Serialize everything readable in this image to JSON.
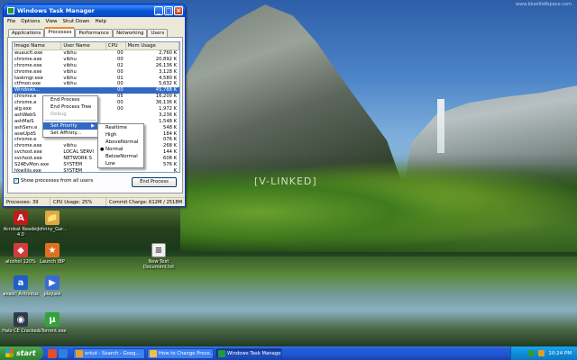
{
  "desktop": {
    "watermark": "[V-LINKED]",
    "site_mark": "www.bluelife8space.com",
    "icons": [
      {
        "label": "Acrobat Reader 4.0",
        "icon": "acrobat-icon",
        "color": "#c21a1a"
      },
      {
        "label": "Johnny_Gar...",
        "icon": "folder-icon",
        "color": "#d9a94a"
      },
      {
        "label": "alcohol 120%",
        "icon": "alcohol-icon",
        "color": "#d23c3c"
      },
      {
        "label": "Launch IBP",
        "icon": "ibp-icon",
        "color": "#e07020"
      },
      {
        "label": "New Text Document.txt",
        "icon": "text-file-icon",
        "color": "#f0f0f0"
      },
      {
        "label": "avast! Antivirus",
        "icon": "avast-icon",
        "color": "#1f5fc7"
      },
      {
        "label": "play.avi",
        "icon": "video-file-icon",
        "color": "#3a6ad4"
      },
      {
        "label": "Halo CE Cracked",
        "icon": "halo-icon",
        "color": "#2f3a4a"
      },
      {
        "label": "uTorrent.exe",
        "icon": "utorrent-icon",
        "color": "#2fa43a"
      }
    ]
  },
  "taskmgr": {
    "title": "Windows Task Manager",
    "menu": [
      "File",
      "Options",
      "View",
      "Shut Down",
      "Help"
    ],
    "tabs": [
      "Applications",
      "Processes",
      "Performance",
      "Networking",
      "Users"
    ],
    "active_tab": "Processes",
    "columns": [
      "Image Name",
      "User Name",
      "CPU",
      "Mem Usage"
    ],
    "rows": [
      {
        "name": "wuauclt.exe",
        "user": "vibhu",
        "cpu": "00",
        "mem": "2,760 K"
      },
      {
        "name": "chrome.exe",
        "user": "vibhu",
        "cpu": "00",
        "mem": "20,892 K"
      },
      {
        "name": "chrome.exe",
        "user": "vibhu",
        "cpu": "02",
        "mem": "26,136 K"
      },
      {
        "name": "chrome.exe",
        "user": "vibhu",
        "cpu": "00",
        "mem": "3,128 K"
      },
      {
        "name": "taskmgr.exe",
        "user": "vibhu",
        "cpu": "01",
        "mem": "4,580 K"
      },
      {
        "name": "ctfmon.exe",
        "user": "vibhu",
        "cpu": "00",
        "mem": "5,632 K"
      },
      {
        "name": "Windows...",
        "user": "",
        "cpu": "00",
        "mem": "45,788 K",
        "selected": true
      },
      {
        "name": "chrome.e",
        "user": "",
        "cpu": "05",
        "mem": "16,200 K"
      },
      {
        "name": "chrome.e",
        "user": "",
        "cpu": "00",
        "mem": "36,136 K"
      },
      {
        "name": "alg.exe",
        "user": "E",
        "cpu": "00",
        "mem": "1,972 K"
      },
      {
        "name": "ashWebS",
        "user": "",
        "cpu": "",
        "mem": "3,236 K"
      },
      {
        "name": "ashMaiS",
        "user": "",
        "cpu": "",
        "mem": "1,548 K"
      },
      {
        "name": "ashServ.e",
        "user": "",
        "cpu": "",
        "mem": "548 K"
      },
      {
        "name": "aswUpdS",
        "user": "",
        "cpu": "",
        "mem": "184 K"
      },
      {
        "name": "chrome.e",
        "user": "",
        "cpu": "",
        "mem": "076 K"
      },
      {
        "name": "chrome.exe",
        "user": "vibhu",
        "cpu": "",
        "mem": "268 K"
      },
      {
        "name": "svchost.exe",
        "user": "LOCAL SERVI",
        "cpu": "",
        "mem": "144 K"
      },
      {
        "name": "svchost.exe",
        "user": "NETWORK S",
        "cpu": "",
        "mem": "608 K"
      },
      {
        "name": "S24EvMon.exe",
        "user": "SYSTEM",
        "cpu": "",
        "mem": "576 K"
      },
      {
        "name": "hkwiliis.exe",
        "user": "SYSTEM",
        "cpu": "",
        "mem": "K"
      }
    ],
    "show_all_label": "Show processes from all users",
    "end_process_label": "End Process",
    "status": {
      "processes": "Processes: 39",
      "cpu": "CPU Usage: 25%",
      "commit": "Commit Charge: 612M / 2518M"
    }
  },
  "context_menu": {
    "items": [
      {
        "label": "End Process",
        "disabled": false
      },
      {
        "label": "End Process Tree",
        "disabled": false
      },
      {
        "label": "Debug",
        "disabled": true
      },
      {
        "label": "Set Priority",
        "disabled": false,
        "submenu": true,
        "highlighted": true
      },
      {
        "label": "Set Affinity...",
        "disabled": false
      }
    ]
  },
  "priority_menu": {
    "items": [
      "Realtime",
      "High",
      "AboveNormal",
      "Normal",
      "BelowNormal",
      "Low"
    ],
    "checked": "Normal"
  },
  "taskbar": {
    "start_label": "start",
    "tasks": [
      {
        "label": "orkut - Search - Goog...",
        "active": false,
        "icon_color": "#e8a020"
      },
      {
        "label": "How to Change Proce...",
        "active": false,
        "icon_color": "#f0c040"
      },
      {
        "label": "Windows Task Manager",
        "active": true,
        "icon_color": "#1f9a3a"
      }
    ],
    "clock": "10:24 PM"
  }
}
